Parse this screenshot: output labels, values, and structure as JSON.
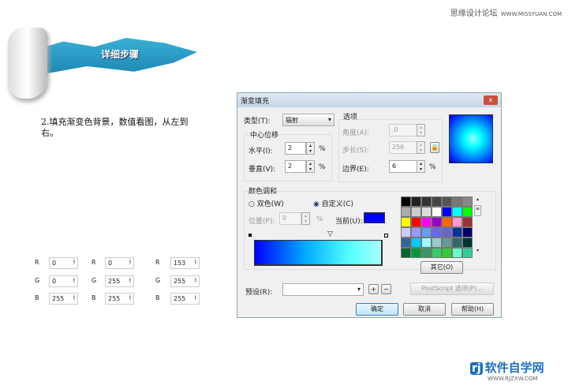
{
  "watermark": {
    "site": "思缘设计论坛",
    "url": "WWW.MISSYUAN.COM"
  },
  "banner": {
    "title": "详细步骤"
  },
  "step_text": "2.填充渐变色背景，数值看图，从左到右。",
  "rgb_sets": [
    {
      "R": "0",
      "G": "0",
      "B": "255"
    },
    {
      "R": "0",
      "G": "255",
      "B": "255"
    },
    {
      "R": "153",
      "G": "255",
      "B": "255"
    }
  ],
  "rgb_labels": {
    "r": "R",
    "g": "G",
    "b": "B"
  },
  "dialog": {
    "title": "渐变填充",
    "close": "x",
    "type_label": "类型(T):",
    "type_value": "辐射",
    "center_offset": "中心位移",
    "horizontal_label": "水平(I):",
    "horizontal_value": "2",
    "vertical_label": "垂直(V):",
    "vertical_value": "2",
    "percent": "%",
    "options": "选项",
    "angle_label": "角度(A):",
    "angle_value": ".0",
    "steps_label": "步长(S):",
    "steps_value": "256",
    "edge_label": "边界(E):",
    "edge_value": "6",
    "color_blend": "颜色调和",
    "two_color": "双色(W)",
    "custom": "自定义(C)",
    "position_label": "位置(P):",
    "position_value": "0",
    "current_label": "当前(U):",
    "current_color": "#0000ff",
    "others": "其它(O)",
    "preset_label": "预设(R):",
    "preset_value": "",
    "postscript": "PostScript 选项(P)...",
    "ok": "确定",
    "cancel": "取消",
    "help": "帮助(H)"
  },
  "palette": [
    "#000000",
    "#222222",
    "#333333",
    "#444444",
    "#555555",
    "#777777",
    "#888888",
    "#aaaaaa",
    "#cccccc",
    "#dddddd",
    "#ffffff",
    "#0000ff",
    "#00ffff",
    "#00ff00",
    "#ffff00",
    "#ff0000",
    "#ff00ff",
    "#9900cc",
    "#ff6600",
    "#ff99cc",
    "#993333",
    "#ccccff",
    "#9999ff",
    "#6699ff",
    "#6666ff",
    "#6666cc",
    "#003399",
    "#000066",
    "#336699",
    "#00ccff",
    "#99ffff",
    "#99cccc",
    "#669999",
    "#336666",
    "#003333",
    "#006633",
    "#009933",
    "#339966",
    "#33cc66",
    "#33cc33",
    "#66ffcc",
    "#33cc99"
  ],
  "logo": {
    "name": "软件自学网",
    "url": "WWW.RJZXW.COM"
  }
}
